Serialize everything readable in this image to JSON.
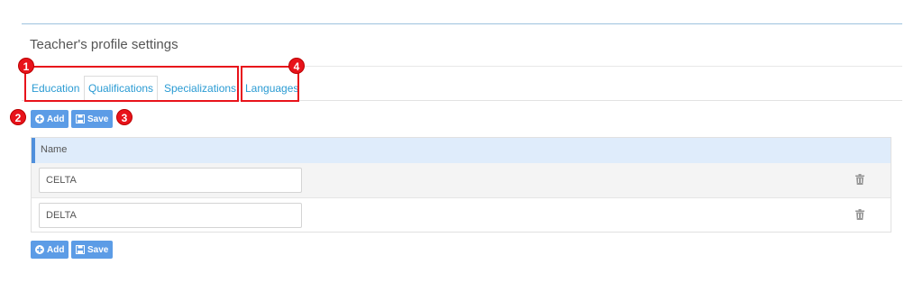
{
  "panel": {
    "title": "Teacher's profile settings"
  },
  "tabs": [
    {
      "label": "Education",
      "active": false
    },
    {
      "label": "Qualifications",
      "active": true
    },
    {
      "label": "Specializations",
      "active": false
    },
    {
      "label": "Languages",
      "active": false
    }
  ],
  "toolbar": {
    "add_label": "Add",
    "save_label": "Save"
  },
  "grid": {
    "column_name": "Name",
    "rows": [
      {
        "name": "CELTA"
      },
      {
        "name": "DELTA"
      }
    ]
  },
  "markers": [
    "1",
    "2",
    "3",
    "4"
  ],
  "colors": {
    "accent": "#2a9bd3",
    "button": "#5c9ce6",
    "highlight": "#e8131b",
    "header_bg": "#dfecfb"
  },
  "icons": {
    "add": "plus-circle-icon",
    "save": "floppy-disk-icon",
    "delete": "trash-icon"
  }
}
